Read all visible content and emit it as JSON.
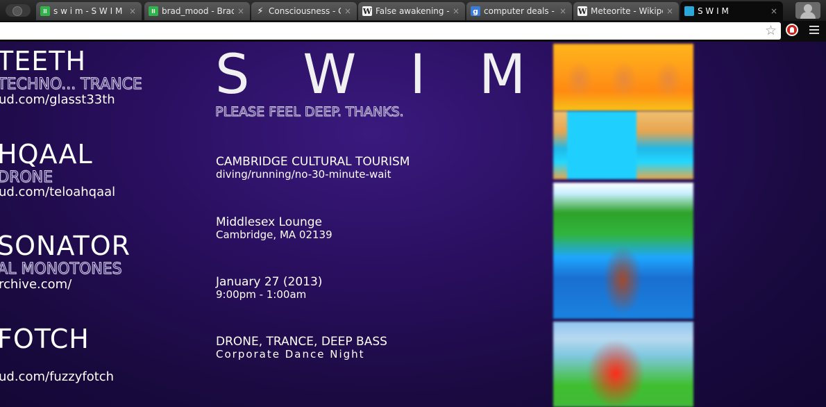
{
  "browser": {
    "tabs": [
      {
        "favicon": "green-dot-icon",
        "title": "s w i m - S W I M",
        "active": false
      },
      {
        "favicon": "green-dot-icon",
        "title": "brad_mood - Brad_",
        "active": false
      },
      {
        "favicon": "bolt-icon",
        "title": "Consciousness - Cl",
        "active": false
      },
      {
        "favicon": "wikipedia-icon",
        "title": "False awakening - \\",
        "active": false
      },
      {
        "favicon": "google-icon",
        "title": "computer deals - C",
        "active": false
      },
      {
        "favicon": "wikipedia-icon",
        "title": "Meteorite - Wikiped",
        "active": false
      },
      {
        "favicon": "swim-icon",
        "title": "S W I M",
        "active": true
      }
    ],
    "close_glyph": "×",
    "address_value": ""
  },
  "artists": [
    {
      "name": "TEETH",
      "genre": "TECHNO... TRANCE",
      "link": "ud.com/glasst33th"
    },
    {
      "name": "HQAAL",
      "genre": "DRONE",
      "link": "ud.com/teloahqaal"
    },
    {
      "name": "SONATOR",
      "genre": "AL MONOTONES",
      "link": "rchive.com/"
    },
    {
      "name": "FOTCH",
      "genre": "",
      "link": "ud.com/fuzzyfotch"
    }
  ],
  "event": {
    "title": "S W I M",
    "tagline": "PLEASE FEEL DEEP. THANKS.",
    "info": [
      {
        "main": "CAMBRIDGE CULTURAL TOURISM",
        "sub": "diving/running/no-30-minute-wait"
      },
      {
        "main": "Middlesex Lounge",
        "sub": "Cambridge, MA 02139"
      },
      {
        "main": "January 27 (2013)",
        "sub": "9:00pm - 1:00am"
      },
      {
        "main": "DRONE, TRANCE, DEEP BASS",
        "sub": "Corporate Dance Night"
      }
    ]
  },
  "colors": {
    "page_background": "#2a0f60",
    "text": "#ffffff",
    "tab_strip": "#1a1a1a"
  }
}
